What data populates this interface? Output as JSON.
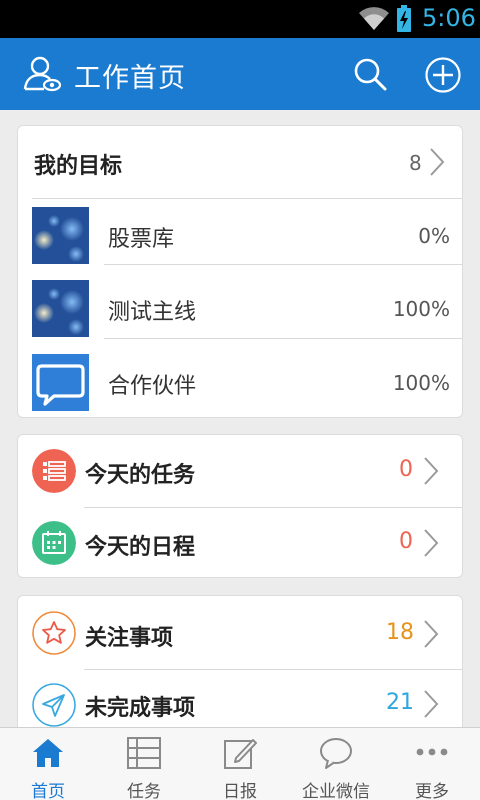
{
  "status_bar": {
    "time": "5:06"
  },
  "app_bar": {
    "title": "工作首页"
  },
  "goals": {
    "title": "我的目标",
    "count": "8",
    "items": [
      {
        "label": "股票库",
        "percent": "0%",
        "icon": "blue-bokeh-thumbnail"
      },
      {
        "label": "测试主线",
        "percent": "100%",
        "icon": "blue-bokeh-thumbnail"
      },
      {
        "label": "合作伙伴",
        "percent": "100%",
        "icon": "chat-bubble-thumbnail"
      }
    ]
  },
  "today": {
    "items": [
      {
        "label": "今天的任务",
        "count": "0",
        "icon": "task-list-icon",
        "icon_color": "#ef6352",
        "count_color": "#ef6352"
      },
      {
        "label": "今天的日程",
        "count": "0",
        "icon": "calendar-icon",
        "icon_color": "#3dbf8a",
        "count_color": "#ef6352"
      }
    ]
  },
  "follow": {
    "items": [
      {
        "label": "关注事项",
        "count": "18",
        "icon": "star-icon",
        "icon_color": "#f08a3c",
        "count_color": "#e8921c"
      },
      {
        "label": "未完成事项",
        "count": "21",
        "icon": "send-icon",
        "icon_color": "#3aa8e0",
        "count_color": "#2ea6df"
      }
    ]
  },
  "bottom_nav": {
    "items": [
      {
        "label": "首页",
        "icon": "home-icon",
        "active": true
      },
      {
        "label": "任务",
        "icon": "task-grid-icon",
        "active": false
      },
      {
        "label": "日报",
        "icon": "edit-icon",
        "active": false
      },
      {
        "label": "企业微信",
        "icon": "chat-icon",
        "active": false
      },
      {
        "label": "更多",
        "icon": "more-icon",
        "active": false
      }
    ]
  },
  "colors": {
    "accent": "#1b7bd0",
    "status_text": "#33b5e5"
  }
}
